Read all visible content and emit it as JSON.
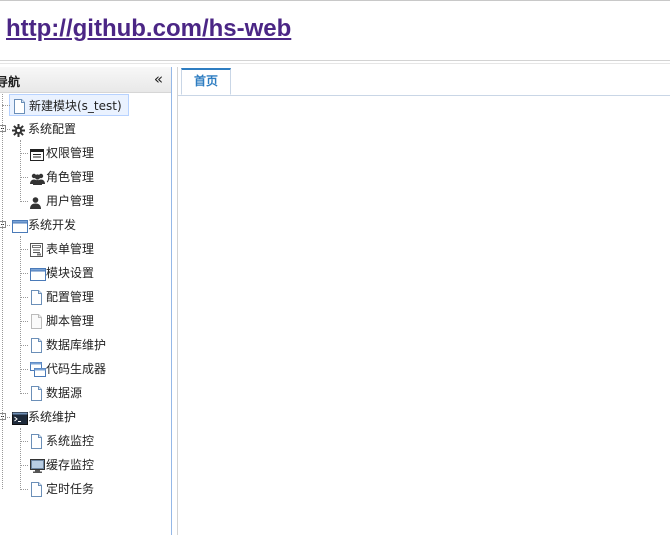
{
  "header": {
    "link_text": "http://github.com/hs-web"
  },
  "sidebar": {
    "title": "导航",
    "collapse_glyph": "«",
    "tree": [
      {
        "label": "新建模块(s_test)",
        "icon": "page-icon",
        "selected": true
      },
      {
        "label": "系统配置",
        "icon": "gear-icon",
        "children": [
          {
            "label": "权限管理",
            "icon": "list-icon"
          },
          {
            "label": "角色管理",
            "icon": "users-icon"
          },
          {
            "label": "用户管理",
            "icon": "user-icon"
          }
        ]
      },
      {
        "label": "系统开发",
        "icon": "window-icon",
        "children": [
          {
            "label": "表单管理",
            "icon": "form-icon"
          },
          {
            "label": "模块设置",
            "icon": "window-icon"
          },
          {
            "label": "配置管理",
            "icon": "page-icon"
          },
          {
            "label": "脚本管理",
            "icon": "blank-page-icon"
          },
          {
            "label": "数据库维护",
            "icon": "page-icon"
          },
          {
            "label": "代码生成器",
            "icon": "windows-stack-icon"
          },
          {
            "label": "数据源",
            "icon": "page-icon"
          }
        ]
      },
      {
        "label": "系统维护",
        "icon": "terminal-icon",
        "children": [
          {
            "label": "系统监控",
            "icon": "page-icon"
          },
          {
            "label": "缓存监控",
            "icon": "monitor-icon"
          },
          {
            "label": "定时任务",
            "icon": "page-icon"
          }
        ]
      }
    ]
  },
  "main": {
    "tabs": [
      {
        "label": "首页",
        "active": true
      }
    ]
  },
  "colors": {
    "link": "#4b2685",
    "tab_accent": "#2e7dc1",
    "panel_border": "#95b8e7",
    "selected_bg": "#eaf2ff"
  }
}
